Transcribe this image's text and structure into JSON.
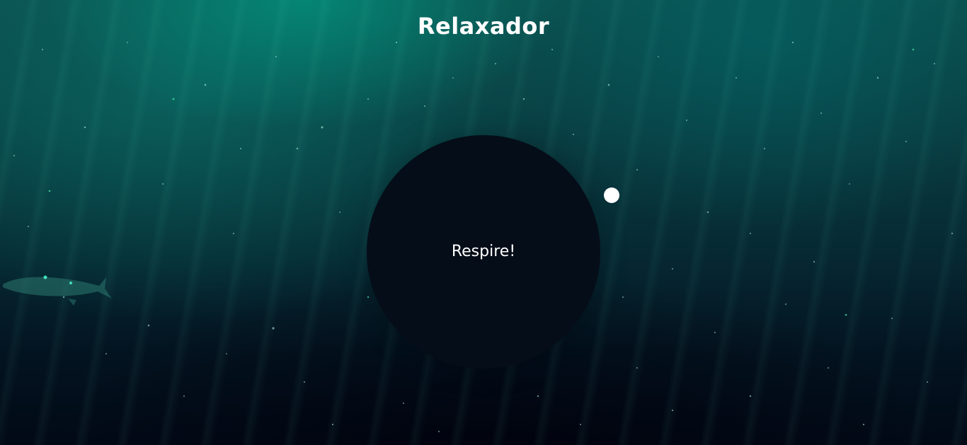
{
  "app": {
    "title": "Relaxador"
  },
  "breathing": {
    "instruction": "Respire!"
  },
  "colors": {
    "circle": "#050d18",
    "text": "#ffffff",
    "pointer": "#ffffff",
    "ocean_top": "#0b4f4f",
    "ocean_bottom": "#020916"
  },
  "background": {
    "icon": "underwater-ocean-background"
  }
}
